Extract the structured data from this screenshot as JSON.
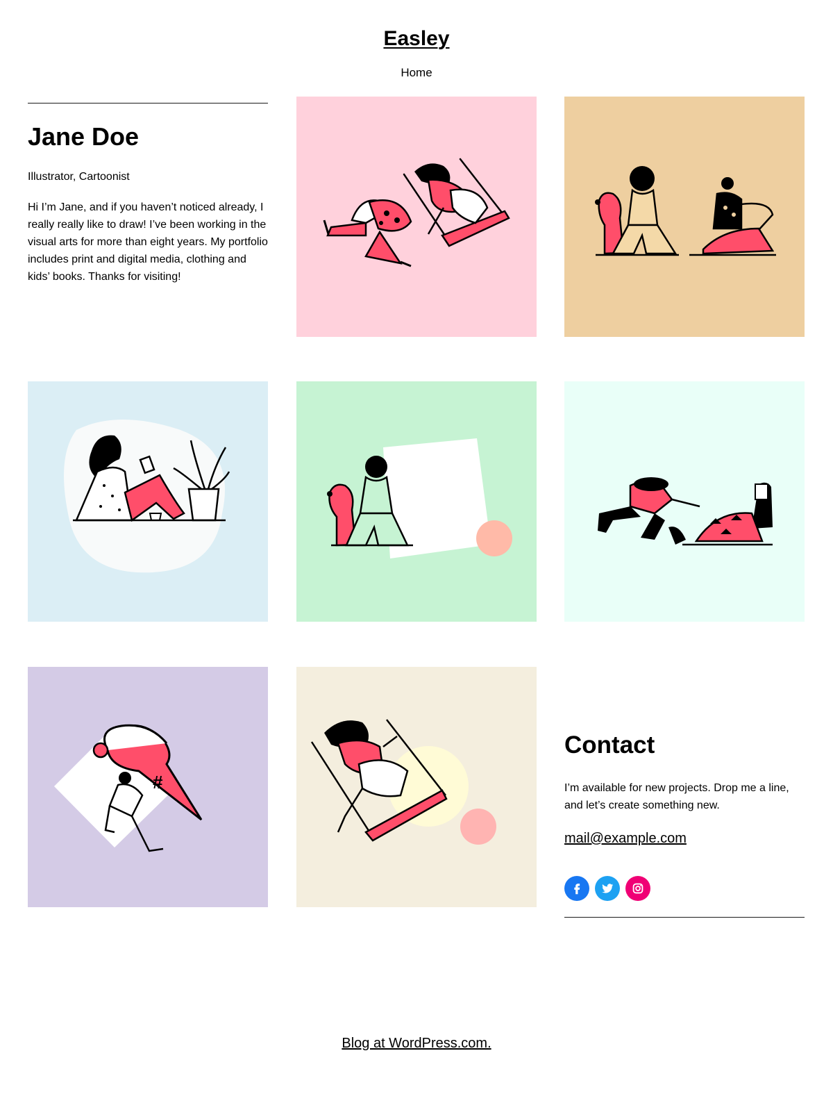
{
  "site": {
    "title": "Easley"
  },
  "nav": {
    "items": [
      {
        "label": "Home"
      }
    ]
  },
  "intro": {
    "name": "Jane Doe",
    "role": "Illustrator, Cartoonist",
    "bio": "Hi I’m Jane, and if you haven’t noticed already, I really really like to draw! I’ve been working in the visual arts for more than eight years. My portfolio includes print and digital media, clothing and kids’ books. Thanks for visiting!"
  },
  "gallery": {
    "tiles": [
      {
        "name": "swing-and-leap-illustration",
        "bg": "#ffd1dc"
      },
      {
        "name": "dog-and-friends-illustration",
        "bg": "#eecfa0"
      },
      {
        "name": "reading-with-plant-illustration",
        "bg": "#dbeef5"
      },
      {
        "name": "dog-with-square-illustration",
        "bg": "#c6f3d3"
      },
      {
        "name": "playful-pair-illustration",
        "bg": "#e9fff8"
      },
      {
        "name": "ice-cream-hug-illustration",
        "bg": "#d4cbe6"
      },
      {
        "name": "swing-with-sun-illustration",
        "bg": "#f4eede"
      }
    ]
  },
  "colors": {
    "accent_red": "#ff4e6a",
    "ink": "#000000"
  },
  "contact": {
    "title": "Contact",
    "text": "I’m available for new projects. Drop me a line, and let’s create something new.",
    "email": "mail@example.com",
    "socials": [
      {
        "name": "Facebook",
        "icon": "facebook-icon",
        "color": "#1877f2"
      },
      {
        "name": "Twitter",
        "icon": "twitter-icon",
        "color": "#1da1f2"
      },
      {
        "name": "Instagram",
        "icon": "instagram-icon",
        "color": "#f00075"
      }
    ]
  },
  "footer": {
    "text": "Blog at WordPress.com."
  }
}
